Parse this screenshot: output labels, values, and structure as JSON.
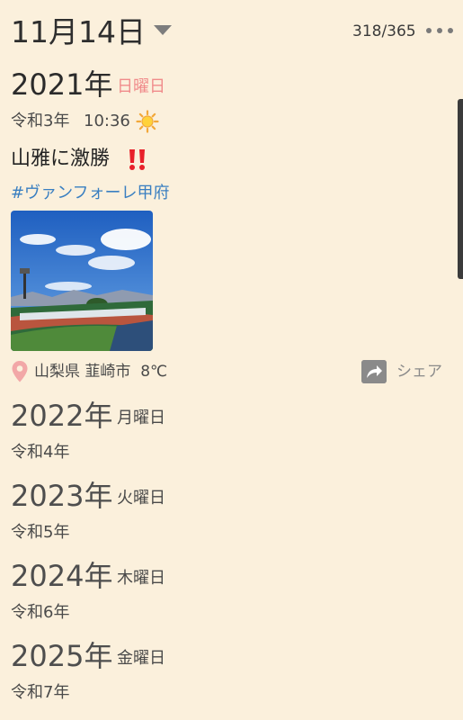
{
  "header": {
    "date": "11月14日",
    "counter": "318/365"
  },
  "entries": [
    {
      "year": "2021年",
      "weekday": "日曜日",
      "era": "令和3年",
      "time": "10:36",
      "weather_icon": "sun-icon",
      "title": "山雅に激勝",
      "title_emoji": "double-exclamation-icon",
      "tag": "#ヴァンフォーレ甲府",
      "photo": "stadium-photo",
      "location": "山梨県 韮崎市",
      "temperature": "8℃",
      "share_label": "シェア"
    },
    {
      "year": "2022年",
      "weekday": "月曜日",
      "era": "令和4年"
    },
    {
      "year": "2023年",
      "weekday": "火曜日",
      "era": "令和5年"
    },
    {
      "year": "2024年",
      "weekday": "木曜日",
      "era": "令和6年"
    },
    {
      "year": "2025年",
      "weekday": "金曜日",
      "era": "令和7年"
    }
  ],
  "colors": {
    "background": "#fbf0dc",
    "sunday": "#f08b8b",
    "tag": "#3a7fc1",
    "pin": "#f2a7a7",
    "share": "#8a8a8a"
  }
}
